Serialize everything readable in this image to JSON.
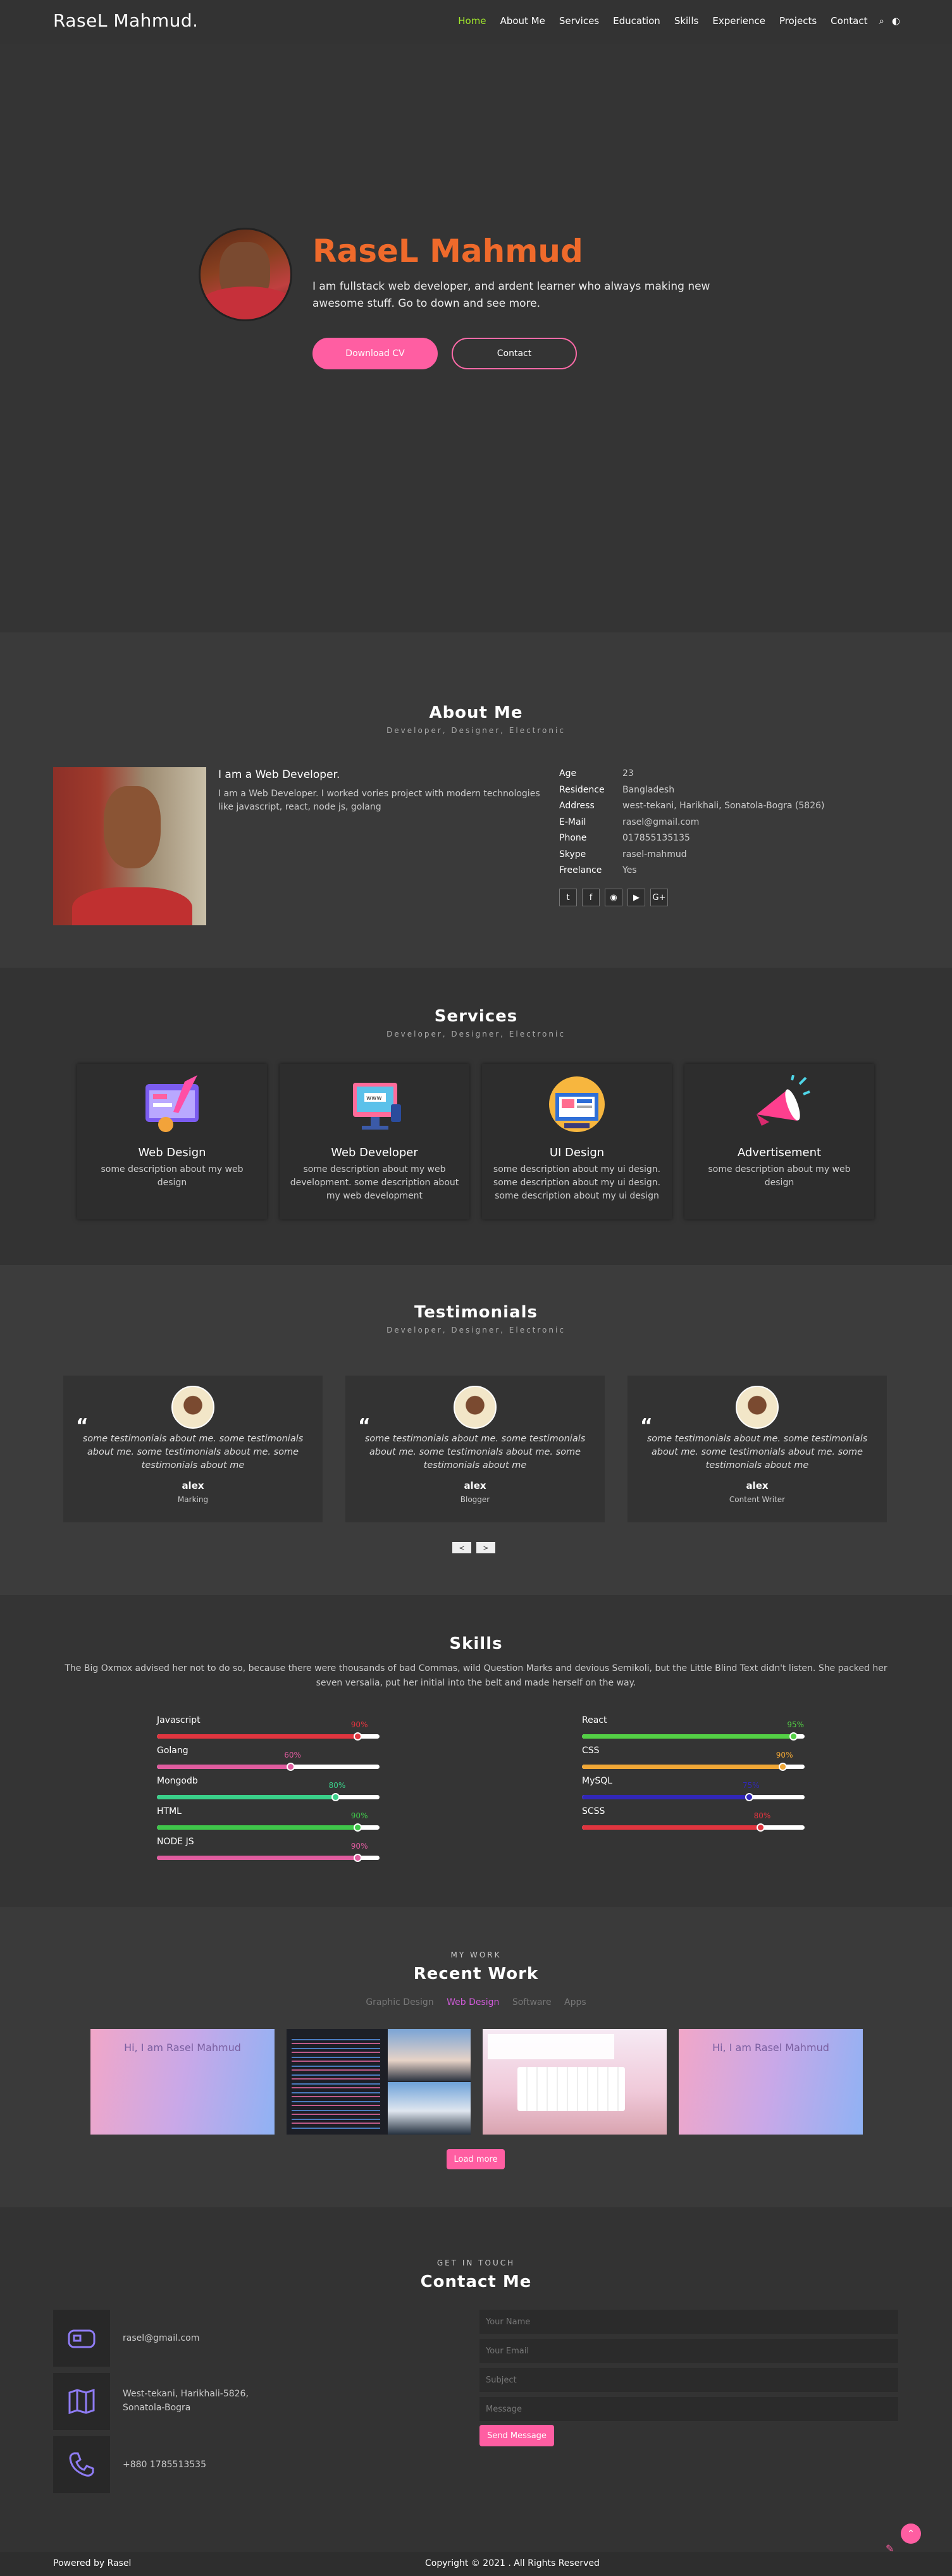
{
  "nav": {
    "logo": "RaseL Mahmud.",
    "items": [
      "Home",
      "About Me",
      "Services",
      "Education",
      "Skills",
      "Experience",
      "Projects",
      "Contact"
    ],
    "active": "Home"
  },
  "hero": {
    "name": "RaseL Mahmud",
    "description": "I am fullstack web developer, and ardent learner who always making new awesome stuff. Go to down and see more.",
    "download_cv": "Download CV",
    "contact": "Contact"
  },
  "about": {
    "title": "About Me",
    "subtitle": "Developer, Designer, Electronic",
    "heading": "I am a Web Developer.",
    "text": "I am a Web Developer. I worked vories project with modern technologies like javascript, react, node js, golang",
    "info": [
      {
        "k": "Age",
        "v": "23"
      },
      {
        "k": "Residence",
        "v": "Bangladesh"
      },
      {
        "k": "Address",
        "v": "west-tekani, Harikhali, Sonatola-Bogra (5826)"
      },
      {
        "k": "E-Mail",
        "v": "rasel@gmail.com"
      },
      {
        "k": "Phone",
        "v": "017855135135"
      },
      {
        "k": "Skype",
        "v": "rasel-mahmud"
      },
      {
        "k": "Freelance",
        "v": "Yes"
      }
    ],
    "social": [
      "twitter-icon",
      "facebook-icon",
      "instagram-icon",
      "youtube-icon",
      "google-plus-icon"
    ]
  },
  "services": {
    "title": "Services",
    "subtitle": "Developer, Designer, Electronic",
    "items": [
      {
        "title": "Web Design",
        "desc": "some description about my web design"
      },
      {
        "title": "Web Developer",
        "desc": "some description about my web development. some description about my web development"
      },
      {
        "title": "UI Design",
        "desc": "some description about my ui design. some description about my ui design. some description about my ui design"
      },
      {
        "title": "Advertisement",
        "desc": "some description about my web design"
      }
    ]
  },
  "testimonials": {
    "title": "Testimonials",
    "subtitle": "Developer, Designer, Electronic",
    "items": [
      {
        "text": "some testimonials about me. some testimonials about me. some testimonials about me. some testimonials about me",
        "name": "alex",
        "role": "Marking"
      },
      {
        "text": "some testimonials about me. some testimonials about me. some testimonials about me. some testimonials about me",
        "name": "alex",
        "role": "Blogger"
      },
      {
        "text": "some testimonials about me. some testimonials about me. some testimonials about me. some testimonials about me",
        "name": "alex",
        "role": "Content Writer"
      }
    ],
    "prev": "<",
    "next": ">"
  },
  "skills": {
    "title": "Skills",
    "desc": "The Big Oxmox advised her not to do so, because there were thousands of bad Commas, wild Question Marks and devious Semikoli, but the Little Blind Text didn't listen. She packed her seven versalia, put her initial into the belt and made herself on the way.",
    "left": [
      {
        "name": "Javascript",
        "pct": "90%",
        "value": 0.9,
        "color": "#e0353f"
      },
      {
        "name": "Golang",
        "pct": "60%",
        "value": 0.6,
        "color": "#e05c9f"
      },
      {
        "name": "Mongodb",
        "pct": "80%",
        "value": 0.8,
        "color": "#3ad08a"
      },
      {
        "name": "HTML",
        "pct": "90%",
        "value": 0.9,
        "color": "#3fc64a"
      },
      {
        "name": "NODE JS",
        "pct": "90%",
        "value": 0.9,
        "color": "#e05c9f"
      }
    ],
    "right": [
      {
        "name": "React",
        "pct": "95%",
        "value": 0.95,
        "color": "#53d045"
      },
      {
        "name": "CSS",
        "pct": "90%",
        "value": 0.9,
        "color": "#f0a736"
      },
      {
        "name": "MySQL",
        "pct": "75%",
        "value": 0.75,
        "color": "#3127b8"
      },
      {
        "name": "SCSS",
        "pct": "80%",
        "value": 0.8,
        "color": "#e0353f"
      }
    ]
  },
  "work": {
    "kicker": "MY WORK",
    "title": "Recent Work",
    "tabs": [
      "Graphic Design",
      "Web Design",
      "Software",
      "Apps"
    ],
    "active_tab": "Web Design",
    "thumb_text": "Hi, I am Rasel Mahmud",
    "load_more": "Load more"
  },
  "contact": {
    "kicker": "GET IN TOUCH",
    "title": "Contact Me",
    "email": "rasel@gmail.com",
    "address": "West-tekani, Harikhali-5826, Sonatola-Bogra",
    "phone": "+880 1785513535",
    "placeholders": {
      "name": "Your Name",
      "email": "Your Email",
      "subject": "Subject",
      "message": "Message"
    },
    "send": "Send Message"
  },
  "footer": {
    "left": "Powered by Rasel",
    "center": "Copyright © 2021 . All Rights Reserved"
  }
}
